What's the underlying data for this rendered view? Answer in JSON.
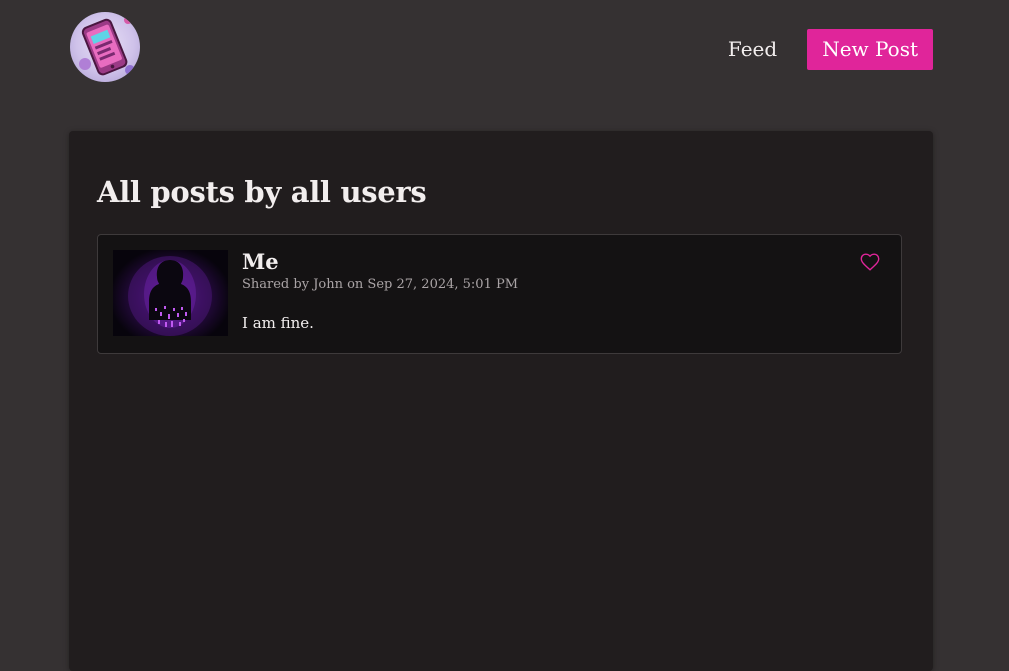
{
  "header": {
    "logo_icon": "phone-app-logo-icon",
    "nav": {
      "feed_label": "Feed",
      "new_post_label": "New Post"
    }
  },
  "colors": {
    "accent": "#e0259a",
    "page_bg": "#353132",
    "panel_bg": "#211d1e",
    "card_bg": "#141213"
  },
  "main": {
    "title": "All posts by all users",
    "posts": [
      {
        "title": "Me",
        "meta": "Shared by John on Sep 27, 2024, 5:01 PM",
        "body": "I am fine.",
        "image_icon": "hooded-figure-image",
        "like_icon": "heart-icon"
      }
    ]
  }
}
